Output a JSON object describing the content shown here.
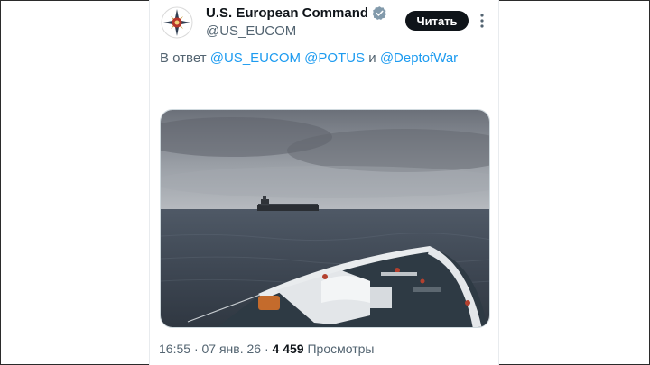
{
  "account": {
    "display_name": "U.S. European Command",
    "handle": "@US_EUCOM",
    "avatar_icon": "eucom-emblem-icon",
    "verified_icon": "verified-badge-icon",
    "verified_color": "#829aab"
  },
  "header": {
    "follow_label": "Читать",
    "more_icon": "more-dots-icon"
  },
  "reply": {
    "prefix": "В ответ",
    "mentions": [
      "@US_EUCOM",
      "@POTUS",
      "@DeptofWar"
    ],
    "separator_and": "и"
  },
  "media": {
    "description_icon": "tanker-at-sea-photo"
  },
  "meta": {
    "time": "16:55",
    "dot": "·",
    "date": "07 янв. 26",
    "views_count": "4 459",
    "views_label": "Просмотры"
  },
  "colors": {
    "link": "#1d9bf0",
    "secondary_text": "#536471",
    "primary_text": "#0f1419",
    "button_bg": "#0f1419"
  }
}
